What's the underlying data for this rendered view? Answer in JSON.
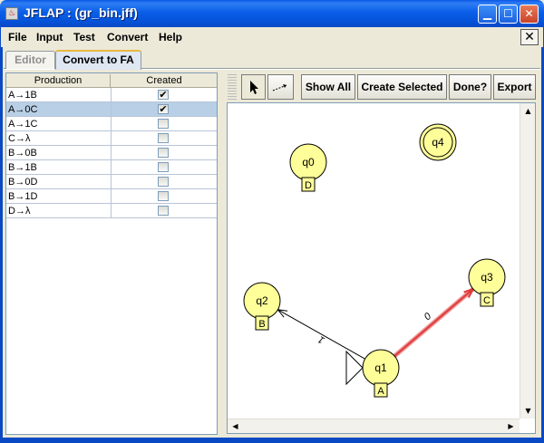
{
  "window": {
    "title": "JFLAP : (gr_bin.jff)"
  },
  "menu": [
    "File",
    "Input",
    "Test",
    "Convert",
    "Help"
  ],
  "tabs": [
    "Editor",
    "Convert to FA"
  ],
  "table": {
    "headers": [
      "Production",
      "Created"
    ],
    "rows": [
      {
        "production": "A→1B",
        "created": true
      },
      {
        "production": "A→0C",
        "created": true
      },
      {
        "production": "A→1C",
        "created": false
      },
      {
        "production": "C→λ",
        "created": false
      },
      {
        "production": "B→0B",
        "created": false
      },
      {
        "production": "B→1B",
        "created": false
      },
      {
        "production": "B→0D",
        "created": false
      },
      {
        "production": "B→1D",
        "created": false
      },
      {
        "production": "D→λ",
        "created": false
      }
    ],
    "selected_row": 1
  },
  "toolbar": {
    "show_all": "Show All",
    "create_selected": "Create Selected",
    "done": "Done?",
    "export": "Export"
  },
  "automaton": {
    "states": [
      {
        "id": "q0",
        "label": "D",
        "initial": false,
        "final": false
      },
      {
        "id": "q1",
        "label": "A",
        "initial": true,
        "final": false
      },
      {
        "id": "q2",
        "label": "B",
        "initial": false,
        "final": false
      },
      {
        "id": "q3",
        "label": "C",
        "initial": false,
        "final": false
      },
      {
        "id": "q4",
        "label": "",
        "initial": false,
        "final": true
      }
    ],
    "transitions": [
      {
        "from": "q1",
        "to": "q2",
        "symbol": "1",
        "highlighted": false
      },
      {
        "from": "q1",
        "to": "q3",
        "symbol": "0",
        "highlighted": true
      }
    ]
  },
  "colors": {
    "state_fill": "#ffff99",
    "highlight_edge": "#e03a3a",
    "title_bar": "#0a58e6",
    "selected_row": "#b8cfe5"
  }
}
